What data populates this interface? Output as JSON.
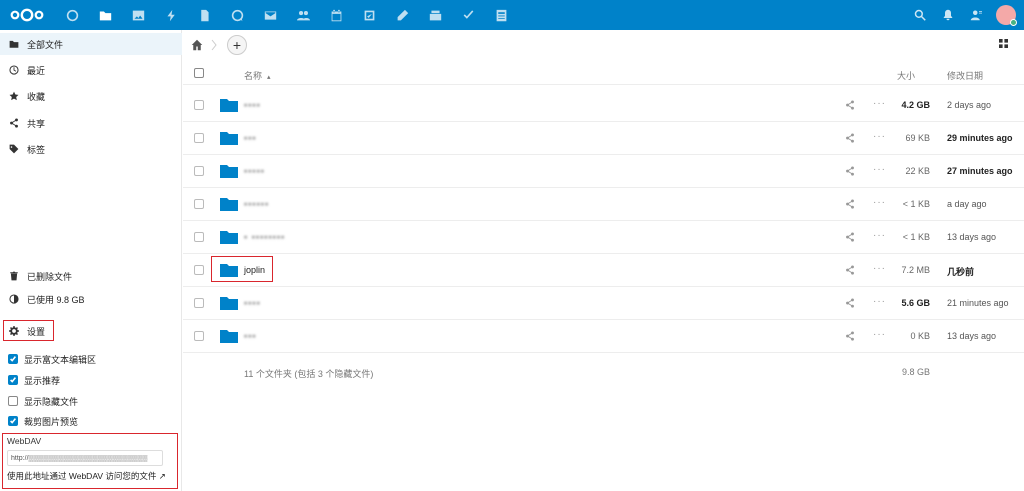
{
  "topbar": {
    "apps": [
      "dashboard-icon",
      "files-icon",
      "photos-icon",
      "activity-icon",
      "notes-icon",
      "talk-icon",
      "mail-icon",
      "contacts-icon",
      "calendar-icon",
      "deck-icon",
      "text-icon",
      "tasks-icon",
      "checklist-icon",
      "news-icon"
    ],
    "right_icons": [
      "search-icon",
      "bell-icon",
      "contacts-menu-icon"
    ],
    "accent": "#0082c9"
  },
  "sidebar": {
    "items": [
      {
        "label": "全部文件",
        "icon": "folder-icon",
        "active": true
      },
      {
        "label": "最近",
        "icon": "clock-icon"
      },
      {
        "label": "收藏",
        "icon": "star-icon"
      },
      {
        "label": "共享",
        "icon": "share-icon"
      },
      {
        "label": "标签",
        "icon": "tag-icon"
      }
    ],
    "trash_label": "已删除文件",
    "quota_label": "已使用 9.8 GB",
    "settings_label": "设置",
    "options": [
      {
        "label": "显示富文本编辑区",
        "checked": true
      },
      {
        "label": "显示推荐",
        "checked": true
      },
      {
        "label": "显示隐藏文件",
        "checked": false
      },
      {
        "label": "裁剪图片预览",
        "checked": true
      }
    ],
    "webdav": {
      "title": "WebDAV",
      "url": "http://▒▒▒▒▒▒▒▒▒▒▒▒▒▒▒▒▒▒▒▒▒▒▒▒",
      "hint": "使用此地址通过 WebDAV 访问您的文件 ↗"
    }
  },
  "files": {
    "header": {
      "name": "名称",
      "sort_indicator": "▴",
      "size": "大小",
      "modified": "修改日期"
    },
    "rows": [
      {
        "name": "▪▪▪▪",
        "blurred": true,
        "size": "4.2 GB",
        "size_bold": true,
        "modified": "2 days ago",
        "modified_bold": false
      },
      {
        "name": "▪▪▪",
        "blurred": true,
        "size": "69 KB",
        "size_bold": false,
        "modified": "29 minutes ago",
        "modified_bold": true
      },
      {
        "name": "▪▪▪▪▪",
        "blurred": true,
        "size": "22 KB",
        "size_bold": false,
        "modified": "27 minutes ago",
        "modified_bold": true
      },
      {
        "name": "▪▪▪▪▪▪",
        "blurred": true,
        "size": "< 1 KB",
        "size_bold": false,
        "modified": "a day ago",
        "modified_bold": false
      },
      {
        "name": "▪ ▪▪▪▪▪▪▪▪",
        "blurred": true,
        "size": "< 1 KB",
        "size_bold": false,
        "modified": "13 days ago",
        "modified_bold": false
      },
      {
        "name": "joplin",
        "blurred": false,
        "size": "7.2 MB",
        "size_bold": false,
        "modified": "几秒前",
        "modified_bold": true
      },
      {
        "name": "▪▪▪▪",
        "blurred": true,
        "size": "5.6 GB",
        "size_bold": true,
        "modified": "21 minutes ago",
        "modified_bold": false
      },
      {
        "name": "▪▪▪",
        "blurred": true,
        "size": "0 KB",
        "size_bold": false,
        "modified": "13 days ago",
        "modified_bold": false
      }
    ],
    "summary_count": "11 个文件夹 (包括 3 个隐藏文件)",
    "summary_size": "9.8 GB"
  }
}
